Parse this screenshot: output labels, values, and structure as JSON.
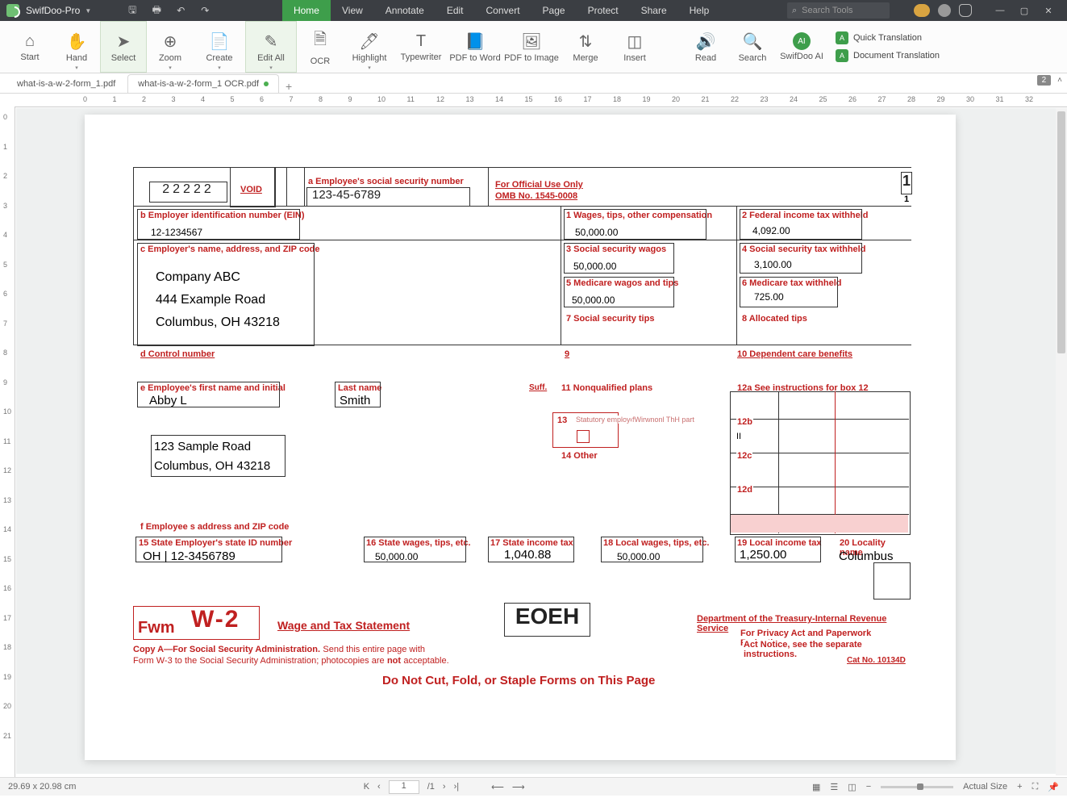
{
  "app": {
    "name": "SwifDoo-Pro"
  },
  "menu": [
    "Home",
    "View",
    "Annotate",
    "Edit",
    "Convert",
    "Page",
    "Protect",
    "Share",
    "Help"
  ],
  "menu_active": 0,
  "search_placeholder": "Search Tools",
  "ribbon": {
    "items": [
      "Start",
      "Hand",
      "Select",
      "Zoom",
      "Create",
      "Edit All",
      "OCR",
      "Highlight",
      "Typewriter",
      "PDF to Word",
      "PDF to Image",
      "Merge",
      "Insert",
      "Read",
      "Search",
      "SwifDoo AI"
    ],
    "ai_items": [
      "Quick Translation",
      "Document Translation"
    ]
  },
  "tabs": [
    {
      "label": "what-is-a-w-2-form_1.pdf",
      "active": false,
      "dirty": false
    },
    {
      "label": "what-is-a-w-2-form_1 OCR.pdf",
      "active": true,
      "dirty": true
    }
  ],
  "page_indicator": "2",
  "status": {
    "dims": "29.69 x 20.98 cm",
    "page_current": "1",
    "page_total": "/1",
    "zoom_label": "Actual Size"
  },
  "nav_icons": {
    "first": "K",
    "prev": "‹",
    "next": "›",
    "last": "›|",
    "back": "⟵",
    "fwd": "⟶"
  },
  "w2": {
    "top_num": "22222",
    "void": "VOID",
    "a_lbl": "a Employee's social security number",
    "a_val": "123-45-6789",
    "official": "For Official Use Only",
    "omb": "OMB No. 1545-0008",
    "one": "1",
    "one_small": "1",
    "b_lbl": "b Employer identification number (EIN)",
    "b_val": "12-1234567",
    "c_lbl": "c Employer's name, address, and ZIP code",
    "c_val1": "Company ABC",
    "c_val2": "444 Example Road",
    "c_val3": "Columbus, OH 43218",
    "d_lbl": "d Control number",
    "nine": "9",
    "box1_lbl": "1 Wages, tips, other compensation",
    "box1_val": "50,000.00",
    "box2_lbl": "2 Federal income tax withheld",
    "box2_val": "4,092.00",
    "box3_lbl": "3 Social security wagos",
    "box3_val": "50,000.00",
    "box4_lbl": "4 Social security tax withheld",
    "box4_val": "3,100.00",
    "box5_lbl": "5 Medicare wagos and tips",
    "box5_val": "50,000.00",
    "box6_lbl": "6 Medicare tax withheld",
    "box6_val": "725.00",
    "box7_lbl": "7 Social security tips",
    "box8_lbl": "8 Allocated tips",
    "box10_lbl": "10 Dependent care benefits",
    "e_lbl": "e Employee's first name and initial",
    "e_val": "Abby L",
    "last_lbl": "Last name",
    "last_val": "Smith",
    "suff_lbl": "Suff.",
    "box11_lbl": "11 Nonqualified plans",
    "box12a_lbl": "12a See instructions for box 12",
    "box12b": "12b",
    "box12c": "12c",
    "box12d": "12d",
    "ii": "II",
    "box13_num": "13",
    "box13_txt": "Statutory employee",
    "box13b": "fWirwnonl ThH part",
    "box14_lbl": "14 Other",
    "addr1": "123 Sample Road",
    "addr2": "Columbus, OH 43218",
    "f_lbl": "f Employee s address and ZIP code",
    "b15_lbl": "15 State Employer's state ID number",
    "b15_val": "OH | 12-3456789",
    "b16_lbl": "16 State wages, tips, etc.",
    "b16_val": "50,000.00",
    "b17_lbl": "17 State income tax",
    "b17_val": "1,040.88",
    "b18_lbl": "18 Local wages, tips, etc.",
    "b18_val": "50,000.00",
    "b19_lbl": "19 Local income tax",
    "b19_val": "1,250.00",
    "b20_lbl": "20 Locality name",
    "b20_val": "Columbus",
    "fwm": "Fwm",
    "w2_big": "W-2",
    "stmt": "Wage and Tax Statement",
    "eoeh": "EOEH",
    "dept": "Department of the Treasury-Internal Revenue Service",
    "priv1": "For Privacy Act and Paperwork Reduction",
    "priv2": "Act Notice, see the separate instructions.",
    "cat": "Cat No. 10134D",
    "copya": "Copy A—For Social Security Administration.",
    "copya2": "Send this entire page with",
    "copya3": "Form W-3 to the Social Security Administration; photocopies are",
    "not": "not",
    "acc": "acceptable.",
    "donotcut": "Do Not Cut, Fold, or Staple Forms on This Page"
  }
}
